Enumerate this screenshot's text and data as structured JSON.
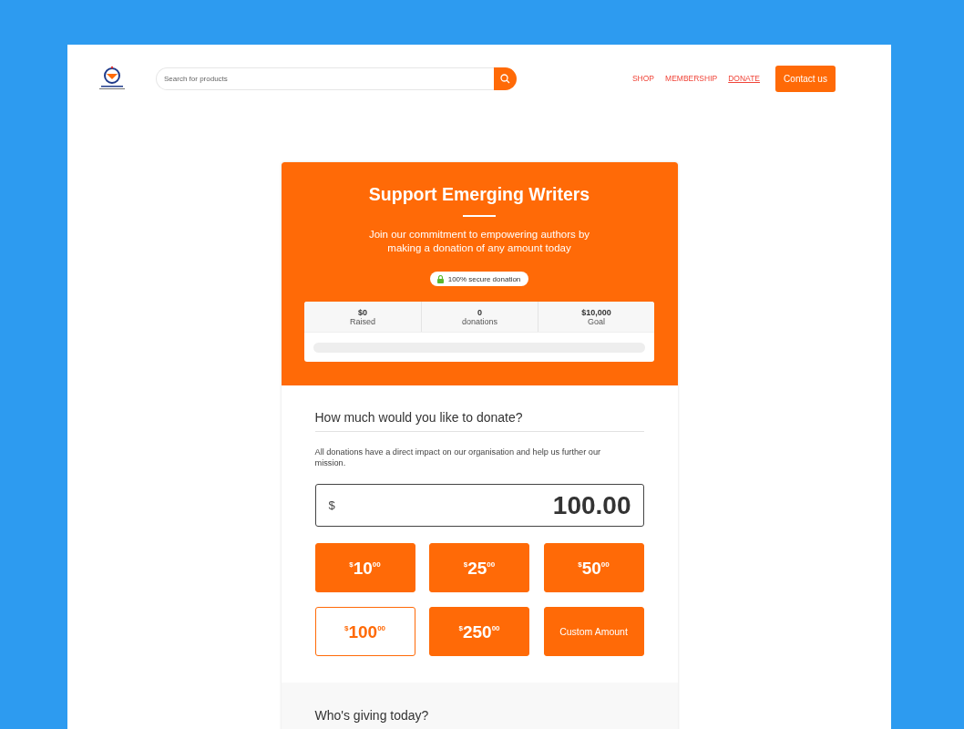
{
  "header": {
    "search": {
      "placeholder": "Search for products"
    },
    "nav": [
      {
        "label": "SHOP",
        "selected": false
      },
      {
        "label": "MEMBERSHIP",
        "selected": false
      },
      {
        "label": "DONATE",
        "selected": true
      }
    ],
    "contact_button": "Contact us"
  },
  "campaign": {
    "title": "Support Emerging Writers",
    "subtitle": "Join our commitment to empowering authors by making a donation of any amount today",
    "badge": "100% secure donation",
    "stats": [
      {
        "value": "$0",
        "label": "Raised"
      },
      {
        "value": "0",
        "label": "donations"
      },
      {
        "value": "$10,000",
        "label": "Goal"
      }
    ],
    "progress": {
      "level": 0
    }
  },
  "amount_section": {
    "heading": "How much would you like to donate?",
    "description": "All donations have a direct impact on our organisation and help us further our mission.",
    "amount_field": {
      "currency": "$",
      "value": "100.00"
    },
    "options": [
      {
        "kind": "amount",
        "currency": "$",
        "whole": "10",
        "cents": "00",
        "selected": false
      },
      {
        "kind": "amount",
        "currency": "$",
        "whole": "25",
        "cents": "00",
        "selected": false
      },
      {
        "kind": "amount",
        "currency": "$",
        "whole": "50",
        "cents": "00",
        "selected": false
      },
      {
        "kind": "amount",
        "currency": "$",
        "whole": "100",
        "cents": "00",
        "selected": true
      },
      {
        "kind": "amount",
        "currency": "$",
        "whole": "250",
        "cents": "00",
        "selected": false
      },
      {
        "kind": "custom",
        "label": "Custom Amount",
        "selected": false
      }
    ]
  },
  "donor_section": {
    "heading": "Who's giving today?"
  }
}
